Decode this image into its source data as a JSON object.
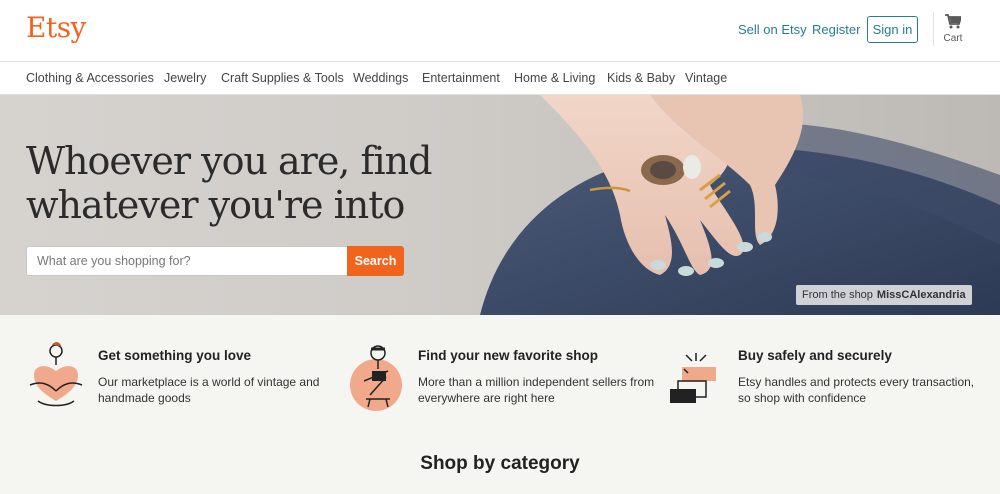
{
  "header": {
    "logo": "Etsy",
    "sell_link": "Sell on Etsy",
    "register_link": "Register",
    "signin_button": "Sign in",
    "cart_label": "Cart",
    "cart_icon": "cart-icon"
  },
  "categories": [
    "Clothing & Accessories",
    "Jewelry",
    "Craft Supplies & Tools",
    "Weddings",
    "Entertainment",
    "Home & Living",
    "Kids & Baby",
    "Vintage"
  ],
  "hero": {
    "title": "Whoever you are, find whatever you're into",
    "search_placeholder": "What are you shopping for?",
    "search_button": "Search",
    "credit_prefix": "From the shop",
    "credit_shop": "MissCAlexandria"
  },
  "features": [
    {
      "icon": "heart-illustration-icon",
      "title": "Get something you love",
      "text": "Our marketplace is a world of vintage and handmade goods"
    },
    {
      "icon": "craftsperson-illustration-icon",
      "title": "Find your new favorite shop",
      "text": "More than a million independent sellers from everywhere are right here"
    },
    {
      "icon": "handshake-illustration-icon",
      "title": "Buy safely and securely",
      "text": "Etsy handles and protects every transaction, so shop with confidence"
    }
  ],
  "shop_by_category": "Shop by category",
  "colors": {
    "brand": "#f1641e",
    "link": "#277d8e",
    "background": "#f5f5f1"
  }
}
